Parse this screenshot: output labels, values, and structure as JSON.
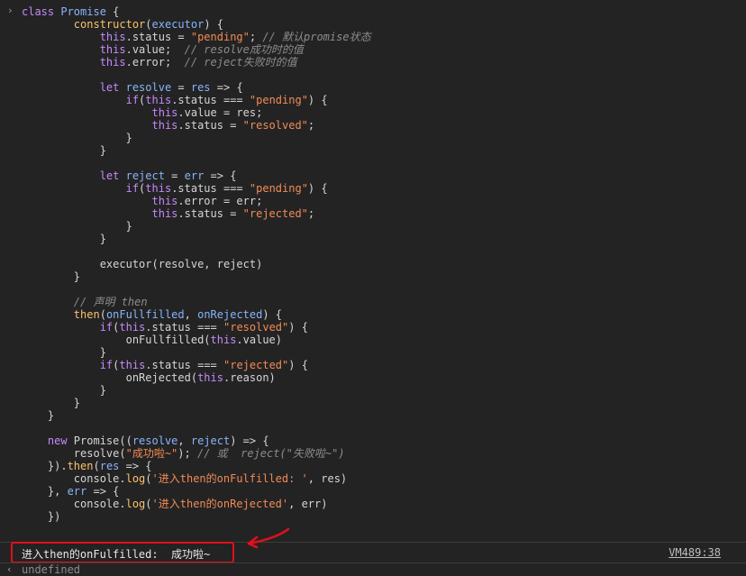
{
  "console": {
    "input_prompt": "›",
    "code_lines": [
      [
        {
          "t": "class ",
          "c": "kw"
        },
        {
          "t": "Promise",
          "c": "prop"
        },
        {
          "t": " {",
          "c": "plain"
        }
      ],
      [
        {
          "t": "        constructor",
          "c": "fn"
        },
        {
          "t": "(",
          "c": "plain"
        },
        {
          "t": "executor",
          "c": "prop"
        },
        {
          "t": ") {",
          "c": "plain"
        }
      ],
      [
        {
          "t": "            this",
          "c": "kw"
        },
        {
          "t": ".status = ",
          "c": "plain"
        },
        {
          "t": "\"pending\"",
          "c": "str"
        },
        {
          "t": "; ",
          "c": "plain"
        },
        {
          "t": "// 默认promise状态",
          "c": "cmt"
        }
      ],
      [
        {
          "t": "            this",
          "c": "kw"
        },
        {
          "t": ".value;  ",
          "c": "plain"
        },
        {
          "t": "// resolve成功时的值",
          "c": "cmt"
        }
      ],
      [
        {
          "t": "            this",
          "c": "kw"
        },
        {
          "t": ".error;  ",
          "c": "plain"
        },
        {
          "t": "// reject失败时的值",
          "c": "cmt"
        }
      ],
      [],
      [
        {
          "t": "            let ",
          "c": "kw"
        },
        {
          "t": "resolve",
          "c": "prop"
        },
        {
          "t": " = ",
          "c": "plain"
        },
        {
          "t": "res",
          "c": "prop"
        },
        {
          "t": " => {",
          "c": "plain"
        }
      ],
      [
        {
          "t": "                if",
          "c": "kw"
        },
        {
          "t": "(",
          "c": "plain"
        },
        {
          "t": "this",
          "c": "kw"
        },
        {
          "t": ".status === ",
          "c": "plain"
        },
        {
          "t": "\"pending\"",
          "c": "str"
        },
        {
          "t": ") {",
          "c": "plain"
        }
      ],
      [
        {
          "t": "                    this",
          "c": "kw"
        },
        {
          "t": ".value = res;",
          "c": "plain"
        }
      ],
      [
        {
          "t": "                    this",
          "c": "kw"
        },
        {
          "t": ".status = ",
          "c": "plain"
        },
        {
          "t": "\"resolved\"",
          "c": "str"
        },
        {
          "t": ";",
          "c": "plain"
        }
      ],
      [
        {
          "t": "                }",
          "c": "plain"
        }
      ],
      [
        {
          "t": "            }",
          "c": "plain"
        }
      ],
      [],
      [
        {
          "t": "            let ",
          "c": "kw"
        },
        {
          "t": "reject",
          "c": "prop"
        },
        {
          "t": " = ",
          "c": "plain"
        },
        {
          "t": "err",
          "c": "prop"
        },
        {
          "t": " => {",
          "c": "plain"
        }
      ],
      [
        {
          "t": "                if",
          "c": "kw"
        },
        {
          "t": "(",
          "c": "plain"
        },
        {
          "t": "this",
          "c": "kw"
        },
        {
          "t": ".status === ",
          "c": "plain"
        },
        {
          "t": "\"pending\"",
          "c": "str"
        },
        {
          "t": ") {",
          "c": "plain"
        }
      ],
      [
        {
          "t": "                    this",
          "c": "kw"
        },
        {
          "t": ".error = err;",
          "c": "plain"
        }
      ],
      [
        {
          "t": "                    this",
          "c": "kw"
        },
        {
          "t": ".status = ",
          "c": "plain"
        },
        {
          "t": "\"rejected\"",
          "c": "str"
        },
        {
          "t": ";",
          "c": "plain"
        }
      ],
      [
        {
          "t": "                }",
          "c": "plain"
        }
      ],
      [
        {
          "t": "            }",
          "c": "plain"
        }
      ],
      [],
      [
        {
          "t": "            executor(resolve, reject)",
          "c": "plain"
        }
      ],
      [
        {
          "t": "        }",
          "c": "plain"
        }
      ],
      [],
      [
        {
          "t": "        // 声明 then",
          "c": "cmt"
        }
      ],
      [
        {
          "t": "        then",
          "c": "fn"
        },
        {
          "t": "(",
          "c": "plain"
        },
        {
          "t": "onFullfilled",
          "c": "prop"
        },
        {
          "t": ", ",
          "c": "plain"
        },
        {
          "t": "onRejected",
          "c": "prop"
        },
        {
          "t": ") {",
          "c": "plain"
        }
      ],
      [
        {
          "t": "            if",
          "c": "kw"
        },
        {
          "t": "(",
          "c": "plain"
        },
        {
          "t": "this",
          "c": "kw"
        },
        {
          "t": ".status === ",
          "c": "plain"
        },
        {
          "t": "\"resolved\"",
          "c": "str"
        },
        {
          "t": ") {",
          "c": "plain"
        }
      ],
      [
        {
          "t": "                onFullfilled(",
          "c": "plain"
        },
        {
          "t": "this",
          "c": "kw"
        },
        {
          "t": ".value)",
          "c": "plain"
        }
      ],
      [
        {
          "t": "            }",
          "c": "plain"
        }
      ],
      [
        {
          "t": "            if",
          "c": "kw"
        },
        {
          "t": "(",
          "c": "plain"
        },
        {
          "t": "this",
          "c": "kw"
        },
        {
          "t": ".status === ",
          "c": "plain"
        },
        {
          "t": "\"rejected\"",
          "c": "str"
        },
        {
          "t": ") {",
          "c": "plain"
        }
      ],
      [
        {
          "t": "                onRejected(",
          "c": "plain"
        },
        {
          "t": "this",
          "c": "kw"
        },
        {
          "t": ".reason)",
          "c": "plain"
        }
      ],
      [
        {
          "t": "            }",
          "c": "plain"
        }
      ],
      [
        {
          "t": "        }",
          "c": "plain"
        }
      ],
      [
        {
          "t": "    }",
          "c": "plain"
        }
      ],
      [],
      [
        {
          "t": "    new ",
          "c": "kw"
        },
        {
          "t": "Promise",
          "c": "plain"
        },
        {
          "t": "((",
          "c": "plain"
        },
        {
          "t": "resolve",
          "c": "prop"
        },
        {
          "t": ", ",
          "c": "plain"
        },
        {
          "t": "reject",
          "c": "prop"
        },
        {
          "t": ") => {",
          "c": "plain"
        }
      ],
      [
        {
          "t": "        resolve(",
          "c": "plain"
        },
        {
          "t": "\"成功啦~\"",
          "c": "str"
        },
        {
          "t": "); ",
          "c": "plain"
        },
        {
          "t": "// 或  reject(\"失败啦~\")",
          "c": "cmt"
        }
      ],
      [
        {
          "t": "    }).",
          "c": "plain"
        },
        {
          "t": "then",
          "c": "fn"
        },
        {
          "t": "(",
          "c": "plain"
        },
        {
          "t": "res",
          "c": "prop"
        },
        {
          "t": " => {",
          "c": "plain"
        }
      ],
      [
        {
          "t": "        console.",
          "c": "plain"
        },
        {
          "t": "log",
          "c": "fn"
        },
        {
          "t": "(",
          "c": "plain"
        },
        {
          "t": "'进入then的onFulfilled: '",
          "c": "str"
        },
        {
          "t": ", res)",
          "c": "plain"
        }
      ],
      [
        {
          "t": "    }, ",
          "c": "plain"
        },
        {
          "t": "err",
          "c": "prop"
        },
        {
          "t": " => {",
          "c": "plain"
        }
      ],
      [
        {
          "t": "        console.",
          "c": "plain"
        },
        {
          "t": "log",
          "c": "fn"
        },
        {
          "t": "(",
          "c": "plain"
        },
        {
          "t": "'进入then的onRejected'",
          "c": "str"
        },
        {
          "t": ", err)",
          "c": "plain"
        }
      ],
      [
        {
          "t": "    })",
          "c": "plain"
        }
      ]
    ],
    "log_message": "进入then的onFulfilled:  成功啦~",
    "log_source": "VM489:38",
    "result_marker": "‹",
    "result_value": "undefined"
  },
  "colors": {
    "background": "#232324",
    "keyword": "#c58af9",
    "function": "#f9c36a",
    "identifier": "#8ab4f8",
    "string": "#f28b54",
    "comment": "#8c8c8c",
    "annotation_red": "#e0101a"
  }
}
